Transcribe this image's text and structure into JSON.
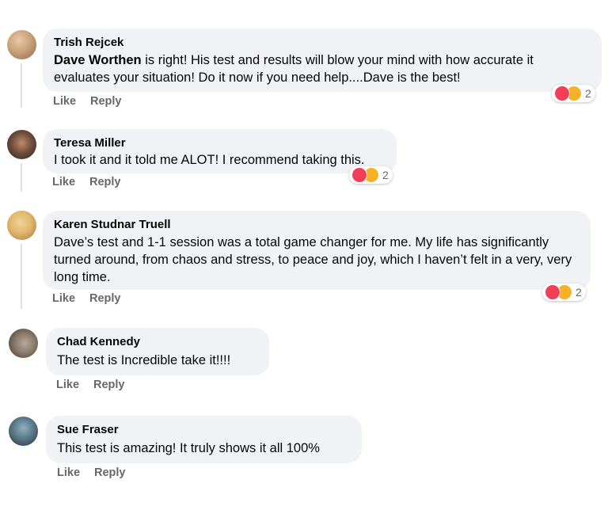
{
  "comments": [
    {
      "author": "Trish Rejcek",
      "mention": "Dave Worthen",
      "text": " is right! His test and results will blow your mind with how accurate it evaluates your situation! Do it now if you need help....Dave is the best!",
      "like_label": "Like",
      "reply_label": "Reply",
      "reaction_count": "2",
      "avatar_colors": [
        "#c9a27a",
        "#8a6a4e"
      ]
    },
    {
      "author": "Teresa Miller",
      "text": "I took it and it told me ALOT! I recommend taking this.",
      "like_label": "Like",
      "reply_label": "Reply",
      "reaction_count": "2",
      "avatar_colors": [
        "#6b4a3a",
        "#2f2520"
      ]
    },
    {
      "author": "Karen Studnar Truell",
      "text": "Dave’s test and 1-1 session was a total game changer for me. My life has significantly turned around, from chaos and stress, to peace and joy, which I haven’t felt in a very, very long time.",
      "like_label": "Like",
      "reply_label": "Reply",
      "reaction_count": "2",
      "avatar_colors": [
        "#e0b86a",
        "#a7764a"
      ]
    },
    {
      "author": "Chad Kennedy",
      "text": "The test is Incredible take it!!!!",
      "like_label": "Like",
      "reply_label": "Reply",
      "avatar_colors": [
        "#8b7b6b",
        "#3e3530"
      ]
    },
    {
      "author": "Sue Fraser",
      "text": "This test is amazing! It truly shows it all 100%",
      "like_label": "Like",
      "reply_label": "Reply",
      "avatar_colors": [
        "#5a7a8a",
        "#2a2e35"
      ]
    }
  ],
  "colors": {
    "bubble_bg": "#f0f2f5",
    "secondary_text": "#65676b",
    "heart_react": "#f33e58",
    "care_react": "#f7b125"
  },
  "icons": {
    "heart": "heart-reaction-icon",
    "care": "care-reaction-icon"
  }
}
